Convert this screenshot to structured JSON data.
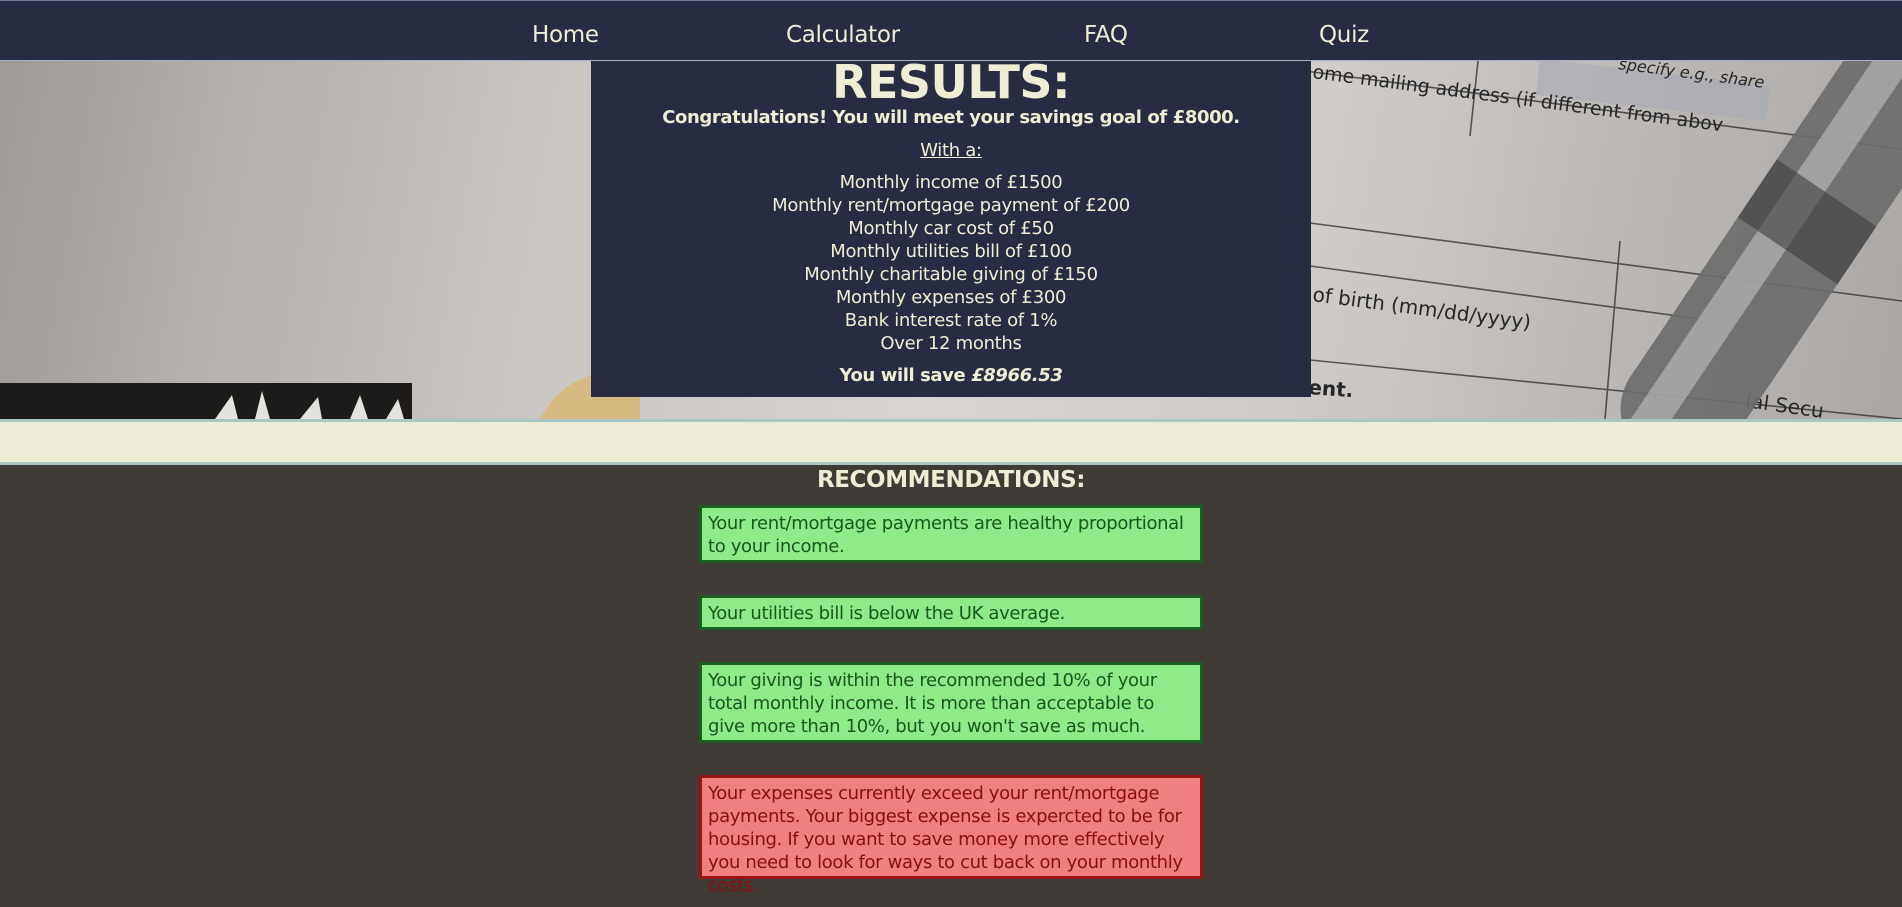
{
  "nav": {
    "items": [
      {
        "label": "Home"
      },
      {
        "label": "Calculator"
      },
      {
        "label": "FAQ"
      },
      {
        "label": "Quiz"
      }
    ]
  },
  "hero": {
    "form_text": {
      "mailing_address": "ome mailing address (if different from abov",
      "specify": "specify e.g., share",
      "dob": "of birth (mm/dd/yyyy)",
      "ent": "ent.",
      "social_security": "ial Secu"
    }
  },
  "results": {
    "title": "RESULTS:",
    "congrats": "Congratulations! You will meet your savings goal of £8000.",
    "with_label": "With a:",
    "lines": [
      "Monthly income of £1500",
      "Monthly rent/mortgage payment of £200",
      "Monthly car cost of £50",
      "Monthly utilities bill of £100",
      "Monthly charitable giving of £150",
      "Monthly expenses of £300",
      "Bank interest rate of 1%",
      "Over 12 months"
    ],
    "save_prefix": "You will save ",
    "save_amount": "£8966.53"
  },
  "recommendations": {
    "title": "RECOMMENDATIONS:",
    "items": [
      {
        "status": "good",
        "text": "Your rent/mortgage payments are healthy proportional to your income."
      },
      {
        "status": "good",
        "text": "Your utilities bill is below the UK average."
      },
      {
        "status": "good",
        "text": "Your giving is within the recommended 10% of your total monthly income. It is more than acceptable to give more than 10%, but you won't save as much."
      },
      {
        "status": "bad",
        "text": "Your expenses currently exceed your rent/mortgage payments. Your biggest expense is expercted to be for housing. If you want to save money more effectively you need to look for ways to cut back on your monthly costs."
      }
    ]
  },
  "colors": {
    "nav_bg": "#282c43",
    "nav_text": "#efedd3",
    "page_bg": "#403b37",
    "band_bg": "#ecedd4",
    "good_bg": "#8eeb89",
    "good_text": "#17581e",
    "bad_bg": "#f08080",
    "bad_text": "#8a0e0e"
  }
}
